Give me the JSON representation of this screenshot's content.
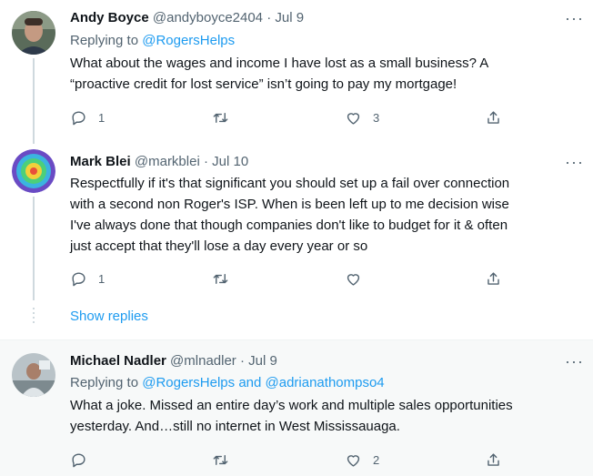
{
  "tweets": [
    {
      "name": "Andy Boyce",
      "handle": "@andyboyce2404",
      "date": "· Jul 9",
      "replying_prefix": "Replying to ",
      "replying_to": "@RogersHelps",
      "text_lines": [
        "What about the wages and income I have lost as a small business?  A",
        "“proactive credit for lost service” isn’t going to pay my mortgage!"
      ],
      "reply_count": "1",
      "retweet_count": "",
      "like_count": "3"
    },
    {
      "name": "Mark Blei",
      "handle": "@markblei",
      "date": "· Jul 10",
      "text_lines": [
        "Respectfully if it's that significant you should set up a fail over connection",
        "with a second non Roger's ISP. When is been left up to me decision wise",
        "I've always done that though companies don't like to budget for it & often",
        "just accept that they'll lose a day every year or so"
      ],
      "reply_count": "1",
      "retweet_count": "",
      "like_count": ""
    },
    {
      "name": "Michael Nadler",
      "handle": "@mlnadler",
      "date": "· Jul 9",
      "replying_prefix": "Replying to ",
      "replying_to": "@RogersHelps and @adrianathompso4",
      "text_lines": [
        "What a joke. Missed an entire day’s work and multiple sales opportunities",
        "yesterday. And…still no internet in West Mississauaga."
      ],
      "reply_count": "",
      "retweet_count": "",
      "like_count": "2"
    }
  ],
  "show_replies_label": "Show replies",
  "more_label": "···",
  "colors": {
    "link": "#1d9bf0",
    "muted": "#536471",
    "highlight_bg": "#f7f9f9"
  },
  "icons": [
    "reply-icon",
    "retweet-icon",
    "like-icon",
    "share-icon",
    "more-icon"
  ]
}
